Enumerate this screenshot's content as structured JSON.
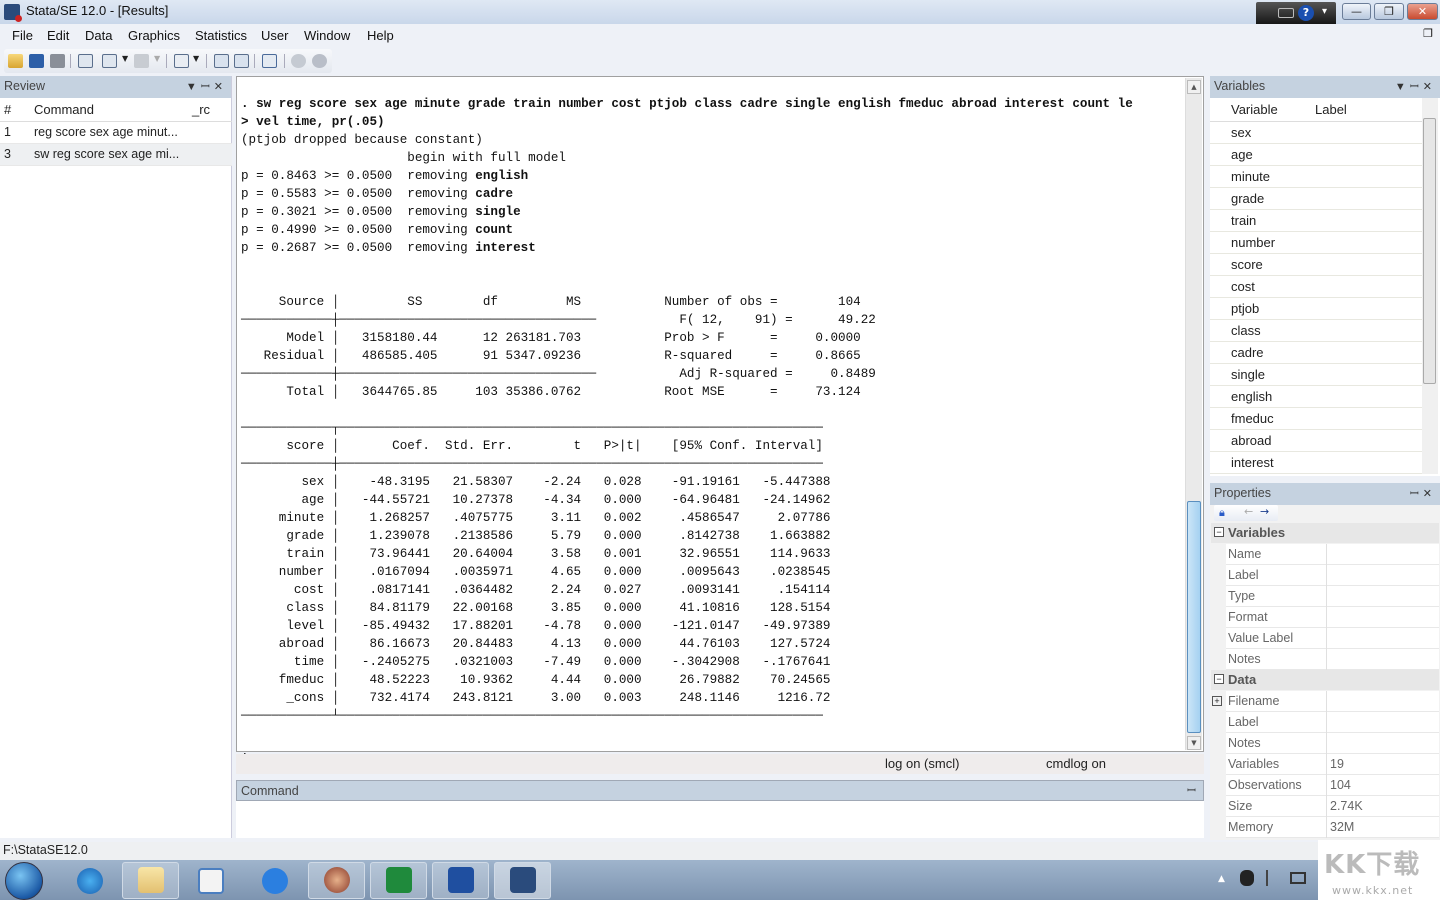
{
  "window": {
    "title": "Stata/SE 12.0 - [Results]",
    "controls": {
      "minimize": "—",
      "maximize": "❐",
      "close": "✕"
    }
  },
  "menubar": [
    "File",
    "Edit",
    "Data",
    "Graphics",
    "Statistics",
    "User",
    "Window",
    "Help"
  ],
  "toolbar": {
    "icons": [
      "open-icon",
      "save-icon",
      "print-icon",
      "log-icon",
      "viewer-icon",
      "graph-icon",
      "do-file-editor-icon",
      "data-editor-icon",
      "data-browser-icon",
      "variables-manager-icon",
      "more-icon",
      "break-icon"
    ]
  },
  "review": {
    "title": "Review",
    "columns": [
      "#",
      "Command",
      "_rc"
    ],
    "rows": [
      {
        "num": "1",
        "command": "reg score sex age minut..."
      },
      {
        "num": "3",
        "command": "sw reg score sex age mi..."
      }
    ]
  },
  "results": {
    "command_line1": ". sw reg score sex age minute grade train number cost ptjob class cadre single english fmeduc abroad interest count le",
    "command_line2": "> vel time, pr(.05)",
    "dropped": "(ptjob dropped because constant)",
    "begin": "                      begin with full model",
    "steps": [
      {
        "p": "0.8463",
        "threshold": "0.0500",
        "var": "english"
      },
      {
        "p": "0.5583",
        "threshold": "0.0500",
        "var": "cadre"
      },
      {
        "p": "0.3021",
        "threshold": "0.0500",
        "var": "single"
      },
      {
        "p": "0.4990",
        "threshold": "0.0500",
        "var": "count"
      },
      {
        "p": "0.2687",
        "threshold": "0.0500",
        "var": "interest"
      }
    ],
    "anova": {
      "headers": [
        "Source",
        "SS",
        "df",
        "MS"
      ],
      "rows": [
        {
          "source": "Model",
          "ss": "3158180.44",
          "df": "12",
          "ms": "263181.703"
        },
        {
          "source": "Residual",
          "ss": "486585.405",
          "df": "91",
          "ms": "5347.09236"
        },
        {
          "source": "Total",
          "ss": "3644765.85",
          "df": "103",
          "ms": "35386.0762"
        }
      ]
    },
    "stats": [
      {
        "label": "Number of obs =",
        "value": "104"
      },
      {
        "label": "F( 12,    91) =",
        "value": "49.22"
      },
      {
        "label": "Prob > F      =",
        "value": "0.0000"
      },
      {
        "label": "R-squared     =",
        "value": "0.8665"
      },
      {
        "label": "Adj R-squared =",
        "value": "0.8489"
      },
      {
        "label": "Root MSE      =",
        "value": "73.124"
      }
    ],
    "coef_table": {
      "depvar": "score",
      "headers": [
        "Coef.",
        "Std. Err.",
        "t",
        "P>|t|",
        "[95% Conf.",
        "Interval]"
      ],
      "rows": [
        [
          "sex",
          "-48.3195",
          "21.58307",
          "-2.24",
          "0.028",
          "-91.19161",
          "-5.447388"
        ],
        [
          "age",
          "-44.55721",
          "10.27378",
          "-4.34",
          "0.000",
          "-64.96481",
          "-24.14962"
        ],
        [
          "minute",
          "1.268257",
          ".4075775",
          "3.11",
          "0.002",
          ".4586547",
          "2.07786"
        ],
        [
          "grade",
          "1.239078",
          ".2138586",
          "5.79",
          "0.000",
          ".8142738",
          "1.663882"
        ],
        [
          "train",
          "73.96441",
          "20.64004",
          "3.58",
          "0.001",
          "32.96551",
          "114.9633"
        ],
        [
          "number",
          ".0167094",
          ".0035971",
          "4.65",
          "0.000",
          ".0095643",
          ".0238545"
        ],
        [
          "cost",
          ".0817141",
          ".0364482",
          "2.24",
          "0.027",
          ".0093141",
          ".154114"
        ],
        [
          "class",
          "84.81179",
          "22.00168",
          "3.85",
          "0.000",
          "41.10816",
          "128.5154"
        ],
        [
          "level",
          "-85.49432",
          "17.88201",
          "-4.78",
          "0.000",
          "-121.0147",
          "-49.97389"
        ],
        [
          "abroad",
          "86.16673",
          "20.84483",
          "4.13",
          "0.000",
          "44.76103",
          "127.5724"
        ],
        [
          "time",
          "-.2405275",
          ".0321003",
          "-7.49",
          "0.000",
          "-.3042908",
          "-.1767641"
        ],
        [
          "fmeduc",
          "48.52223",
          "10.9362",
          "4.44",
          "0.000",
          "26.79882",
          "70.24565"
        ],
        [
          "_cons",
          "732.4174",
          "243.8121",
          "3.00",
          "0.003",
          "248.1146",
          "1216.72"
        ]
      ]
    },
    "prompt": "."
  },
  "statusbar": {
    "log": "log on (smcl)",
    "cmdlog": "cmdlog on"
  },
  "command_panel": {
    "title": "Command",
    "value": ""
  },
  "variables": {
    "title": "Variables",
    "columns": [
      "Variable",
      "Label"
    ],
    "items": [
      "sex",
      "age",
      "minute",
      "grade",
      "train",
      "number",
      "score",
      "cost",
      "ptjob",
      "class",
      "cadre",
      "single",
      "english",
      "fmeduc",
      "abroad",
      "interest"
    ]
  },
  "properties": {
    "title": "Properties",
    "groups": [
      {
        "name": "Variables",
        "rows": [
          {
            "k": "Name",
            "v": ""
          },
          {
            "k": "Label",
            "v": ""
          },
          {
            "k": "Type",
            "v": ""
          },
          {
            "k": "Format",
            "v": ""
          },
          {
            "k": "Value Label",
            "v": ""
          },
          {
            "k": "Notes",
            "v": ""
          }
        ]
      },
      {
        "name": "Data",
        "rows": [
          {
            "k": "Filename",
            "v": ""
          },
          {
            "k": "Label",
            "v": ""
          },
          {
            "k": "Notes",
            "v": ""
          },
          {
            "k": "Variables",
            "v": "19"
          },
          {
            "k": "Observations",
            "v": "104"
          },
          {
            "k": "Size",
            "v": "2.74K"
          },
          {
            "k": "Memory",
            "v": "32M"
          }
        ]
      }
    ]
  },
  "pathbar": "F:\\StataSE12.0",
  "taskbar": {
    "apps": [
      "internet-explorer",
      "file-explorer",
      "media-player",
      "sogou",
      "photo-app",
      "excel",
      "word",
      "stata"
    ]
  },
  "watermark": {
    "title": "KK下载",
    "url": "www.kkx.net"
  }
}
